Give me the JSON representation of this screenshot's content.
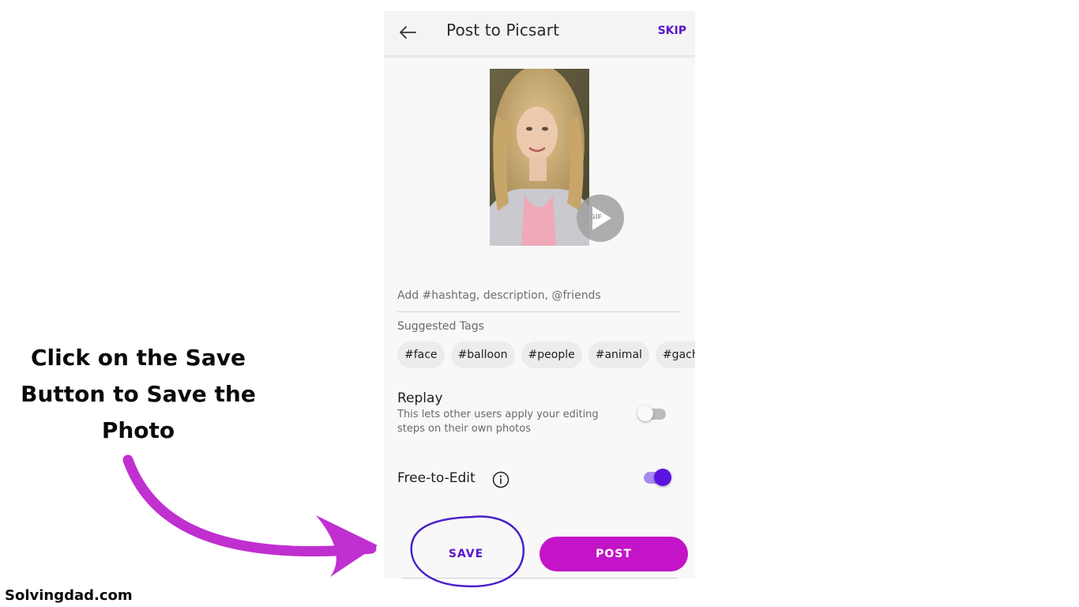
{
  "header": {
    "title": "Post to Picsart",
    "skip_label": "SKIP",
    "back_icon": "arrow-left-icon"
  },
  "media": {
    "gif_badge_label": "GIF",
    "badge_icon": "play-icon"
  },
  "caption": {
    "placeholder": "Add #hashtag, description, @friends",
    "value": ""
  },
  "suggested_tags": {
    "label": "Suggested Tags",
    "tags": [
      "#face",
      "#balloon",
      "#people",
      "#animal",
      "#gacha"
    ]
  },
  "replay": {
    "title": "Replay",
    "description": "This lets other users apply your editing steps on their own photos",
    "enabled": false
  },
  "free_to_edit": {
    "label": "Free-to-Edit",
    "info_icon": "info-circle-icon",
    "enabled": true
  },
  "actions": {
    "save_label": "SAVE",
    "post_label": "POST"
  },
  "annotation": {
    "instruction": "Click on the Save Button to Save the Photo",
    "watermark": "Solvingdad.com"
  },
  "colors": {
    "accent_purple": "#5a16c8",
    "post_magenta": "#c414c8",
    "toggle_on": "#5b13e0",
    "annotation_arrow": "#c02fd0",
    "annotation_circle": "#4a1fc8"
  }
}
